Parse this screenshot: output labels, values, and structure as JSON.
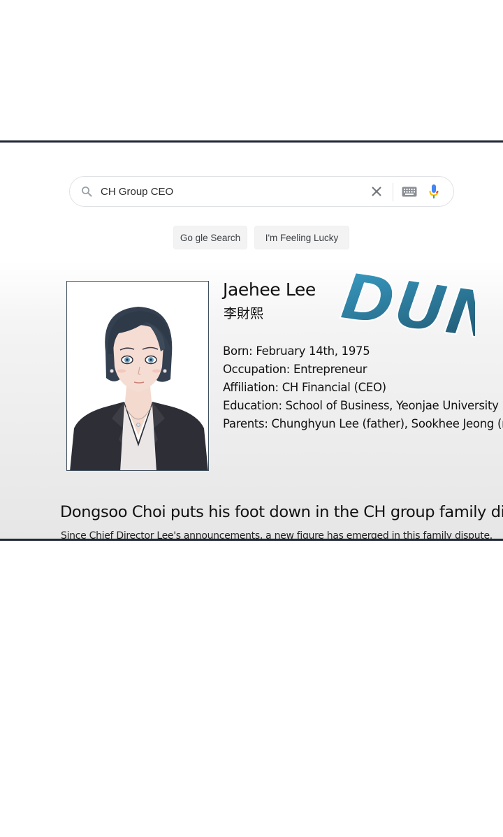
{
  "search": {
    "query": "CH Group CEO"
  },
  "buttons": {
    "search_label": "Go gle Search",
    "lucky_label": "I'm Feeling Lucky"
  },
  "profile": {
    "name": "Jaehee Lee",
    "hanja": "李財熙",
    "facts": [
      "Born: February 14th, 1975",
      "Occupation: Entrepreneur",
      "Affiliation: CH Financial (CEO)",
      "Education: School of Business, Yeonjae University",
      "Parents: Chunghyun Lee (father), Sookhee Jeong (mother)"
    ]
  },
  "sound_effect": "DUN",
  "news": {
    "headline": "Dongsoo Choi puts his foot down in the CH group family dispute",
    "snippet": "Since Chief Director Lee's announcements, a new figure has emerged in this family dispute."
  },
  "colors": {
    "frame_border": "#1f2535",
    "sfx_blue": "#3aa0c8",
    "sfx_dark": "#1c4b63",
    "mic_blue": "#4285f4",
    "mic_red": "#ea4335"
  }
}
